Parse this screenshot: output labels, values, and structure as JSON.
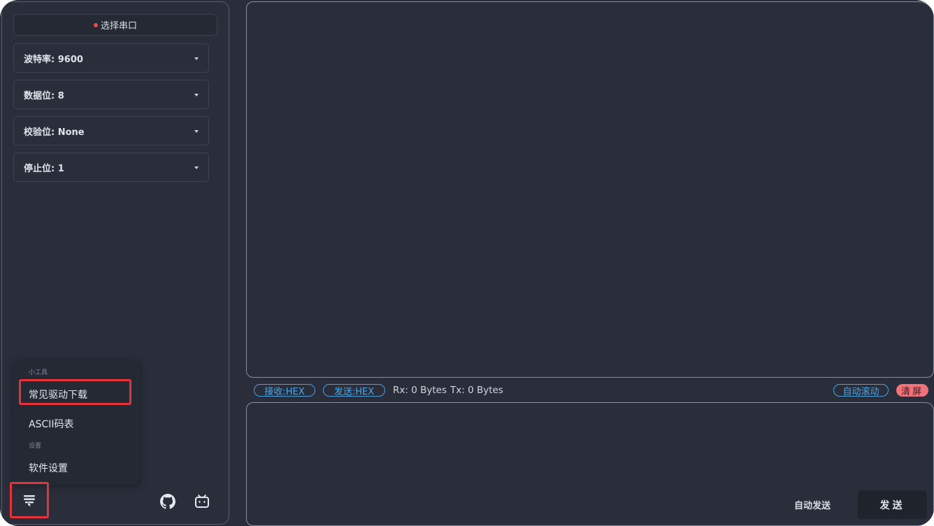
{
  "sidebar": {
    "port_button": {
      "label": "选择串口",
      "status_color": "#f04747"
    },
    "selects": [
      {
        "label": "波特率: 9600"
      },
      {
        "label": "数据位: 8"
      },
      {
        "label": "校验位: None"
      },
      {
        "label": "停止位: 1"
      }
    ],
    "menu": {
      "group_tools": "小工具",
      "item_drivers": "常见驱动下载",
      "item_ascii": "ASCII码表",
      "group_settings": "设置",
      "item_software_settings": "软件设置"
    },
    "bottom_icons": [
      "menu-icon",
      "github-icon",
      "bilibili-icon"
    ]
  },
  "statusbar": {
    "recv_hex": "接收:HEX",
    "send_hex": "发送:HEX",
    "rx": "Rx: 0 Bytes",
    "tx": "Tx: 0 Bytes",
    "auto_scroll": "自动滚动",
    "clear": "清屏"
  },
  "send_panel": {
    "auto_send": "自动发送",
    "send": "发送"
  },
  "colors": {
    "background": "#292e3a",
    "accent_blue": "#4aa3df",
    "clear_red": "#f0737a",
    "highlight_red": "#e8323a"
  }
}
